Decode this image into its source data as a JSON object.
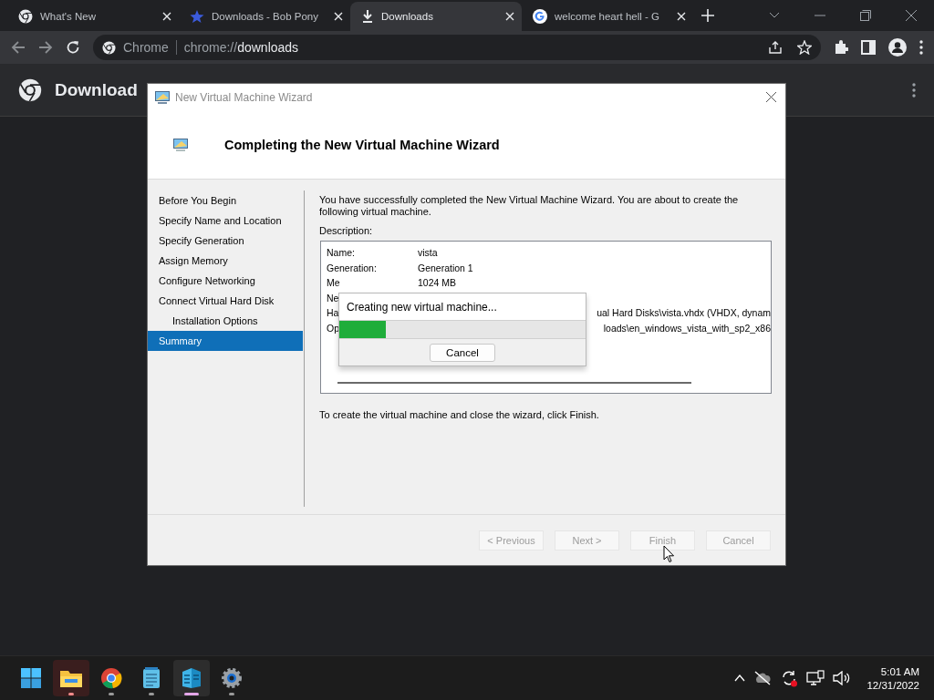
{
  "browser": {
    "tabs": [
      {
        "title": "What's New",
        "kind": "chrome",
        "selected": false
      },
      {
        "title": "Downloads - Bob Pony",
        "kind": "star",
        "selected": false
      },
      {
        "title": "Downloads",
        "kind": "download",
        "selected": true
      },
      {
        "title": "welcome heart hell - G",
        "kind": "google",
        "selected": false
      }
    ],
    "omnibox": {
      "chip": "Chrome",
      "url_prefix": "chrome://",
      "url_host": "downloads"
    }
  },
  "page": {
    "title": "Download"
  },
  "wizard": {
    "title": "New Virtual Machine Wizard",
    "heading": "Completing the New Virtual Machine Wizard",
    "steps": [
      {
        "label": "Before You Begin",
        "selected": false
      },
      {
        "label": "Specify Name and Location",
        "selected": false
      },
      {
        "label": "Specify Generation",
        "selected": false
      },
      {
        "label": "Assign Memory",
        "selected": false
      },
      {
        "label": "Configure Networking",
        "selected": false
      },
      {
        "label": "Connect Virtual Hard Disk",
        "selected": false,
        "children": [
          {
            "label": "Installation Options",
            "selected": false
          }
        ]
      },
      {
        "label": "Summary",
        "selected": true
      }
    ],
    "intro": "You have successfully completed the New Virtual Machine Wizard. You are about to create the following virtual machine.",
    "description_label": "Description:",
    "description": [
      {
        "label": "Name:",
        "value": "vista"
      },
      {
        "label": "Generation:",
        "value": "Generation 1"
      },
      {
        "label": "Me",
        "value": "1024 MB"
      },
      {
        "label": "Ne"
      },
      {
        "label": "Ha",
        "tail": "ual Hard Disks\\vista.vhdx (VHDX, dynam"
      },
      {
        "label": "Op",
        "tail": "loads\\en_windows_vista_with_sp2_x86"
      }
    ],
    "finish_note": "To create the virtual machine and close the wizard, click Finish.",
    "buttons": [
      {
        "label": "< Previous",
        "disabled": true
      },
      {
        "label": "Next >",
        "disabled": true
      },
      {
        "label": "Finish",
        "disabled": true
      },
      {
        "label": "Cancel",
        "disabled": true
      }
    ],
    "progress": {
      "message": "Creating new virtual machine...",
      "level": 0.19,
      "button": "Cancel"
    }
  },
  "taskbar": {
    "apps": [
      {
        "kind": "folder",
        "highlighted": true,
        "active": false
      },
      {
        "kind": "chrome",
        "highlighted": false,
        "active": false
      },
      {
        "kind": "notepad",
        "highlighted": false,
        "active": false
      },
      {
        "kind": "hyperv",
        "highlighted": true,
        "active": true
      },
      {
        "kind": "settings",
        "highlighted": false,
        "active": false
      }
    ],
    "time": "5:01 AM",
    "date": "12/31/2022"
  }
}
